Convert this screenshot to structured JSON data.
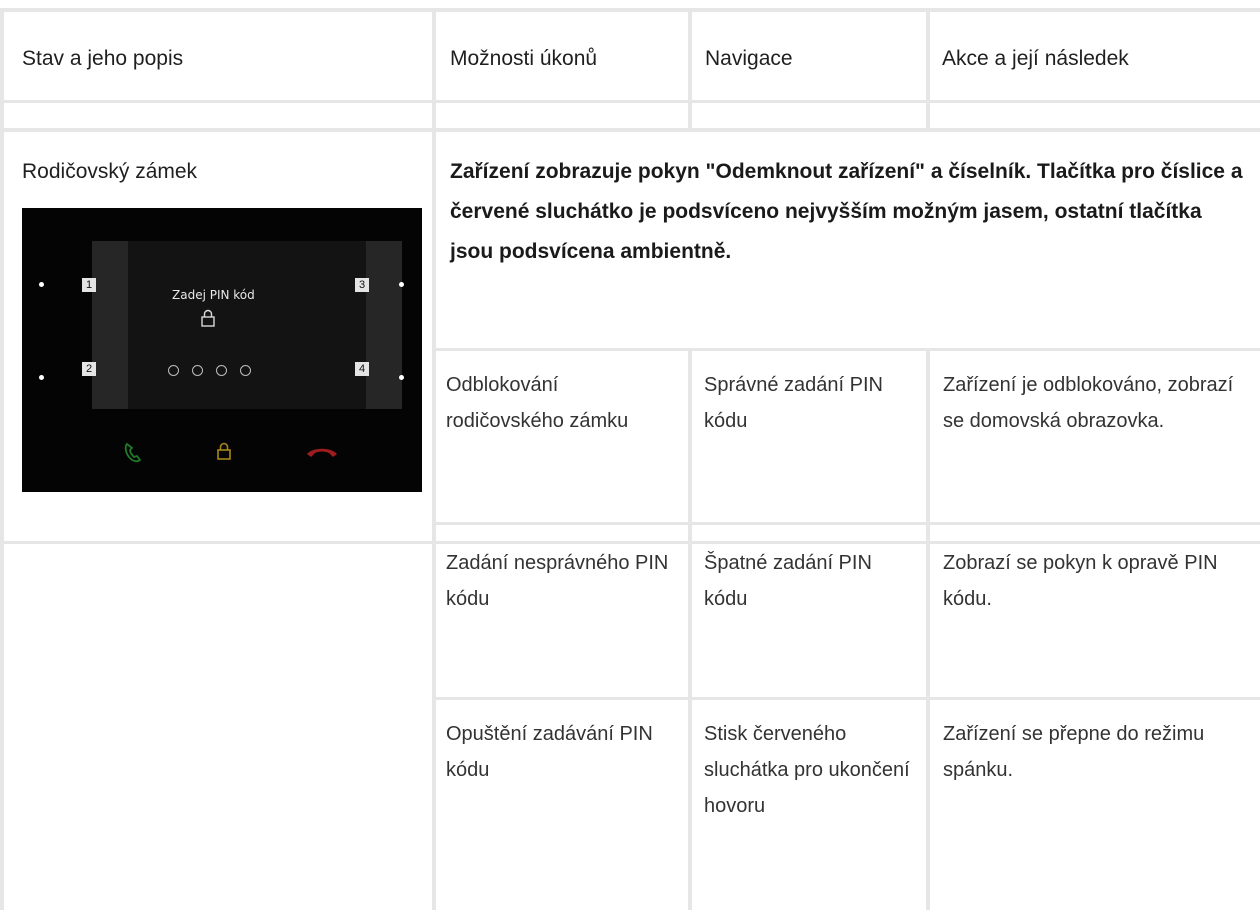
{
  "table": {
    "headers": [
      "Stav a jeho popis",
      "Možnosti úkonů",
      "Navigace",
      "Akce a její následek"
    ],
    "state": {
      "title": "Rodičovský zámek",
      "description": "Zařízení zobrazuje pokyn \"Odemknout zařízení\" a číselník. Tlačítka pro číslice a červené sluchátko je podsvíceno nejvyšším možným jasem, ostatní tlačítka jsou podsvícena ambientně."
    },
    "rows": [
      {
        "action": "Odblokování rodičovského zámku",
        "navigation": "Správné zadání PIN kódu",
        "result": "Zařízení je odblokováno, zobrazí se domovská obrazovka."
      },
      {
        "action": "Zadání nesprávného PIN kódu",
        "navigation": "Špatné zadání PIN kódu",
        "result": "Zobrazí se pokyn k opravě PIN kódu."
      },
      {
        "action": "Opuštění zadávání PIN kódu",
        "navigation": "Stisk červeného sluchátka pro ukončení hovoru",
        "result": "Zařízení se přepne do režimu spánku."
      }
    ]
  },
  "device_screen": {
    "prompt": "Zadej PIN kód",
    "buttons": [
      "1",
      "2",
      "3",
      "4"
    ],
    "icons": [
      "lock-icon",
      "green-handset-icon",
      "yellow-lock-icon",
      "red-handset-icon"
    ],
    "colors": {
      "green": "#1f7a2a",
      "yellow": "#a6861b",
      "red": "#a11d1d"
    }
  }
}
